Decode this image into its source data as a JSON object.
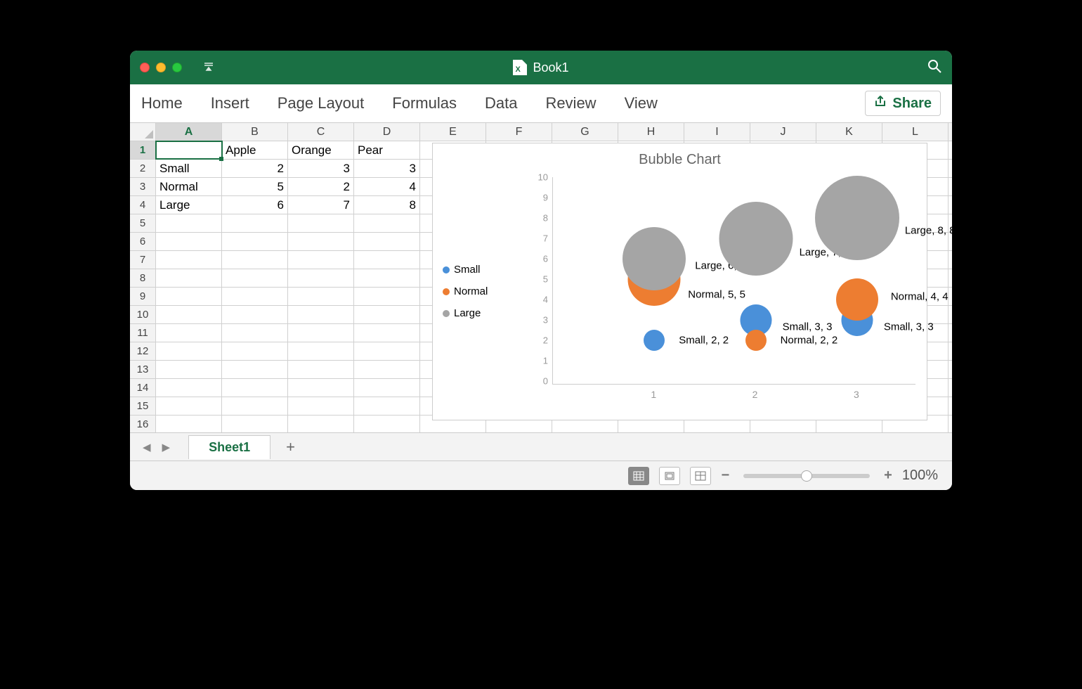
{
  "window": {
    "title": "Book1"
  },
  "ribbon": {
    "tabs": [
      "Home",
      "Insert",
      "Page Layout",
      "Formulas",
      "Data",
      "Review",
      "View"
    ],
    "share_label": "Share"
  },
  "sheet": {
    "columns": [
      "A",
      "B",
      "C",
      "D",
      "E",
      "F",
      "G",
      "H",
      "I",
      "J",
      "K",
      "L"
    ],
    "row_count": 16,
    "active_cell": "A1",
    "cells": {
      "B1": "Apple",
      "C1": "Orange",
      "D1": "Pear",
      "A2": "Small",
      "B2": "2",
      "C2": "3",
      "D2": "3",
      "A3": "Normal",
      "B3": "5",
      "C3": "2",
      "D3": "4",
      "A4": "Large",
      "B4": "6",
      "C4": "7",
      "D4": "8"
    }
  },
  "sheet_tab": {
    "name": "Sheet1"
  },
  "status": {
    "zoom_label": "100%"
  },
  "chart_data": {
    "type": "bubble",
    "title": "Bubble Chart",
    "xlabel": "",
    "ylabel": "",
    "xlim": [
      0,
      3.5
    ],
    "ylim": [
      0,
      10
    ],
    "xticks": [
      1,
      2,
      3
    ],
    "yticks": [
      0,
      1,
      2,
      3,
      4,
      5,
      6,
      7,
      8,
      9,
      10
    ],
    "x_categories_meaning": [
      "Apple",
      "Orange",
      "Pear"
    ],
    "series": [
      {
        "name": "Small",
        "color": "#4a90d9",
        "points": [
          {
            "x": 1,
            "y": 2,
            "size": 2,
            "label": "Small, 2, 2"
          },
          {
            "x": 2,
            "y": 3,
            "size": 3,
            "label": "Small, 3, 3"
          },
          {
            "x": 3,
            "y": 3,
            "size": 3,
            "label": "Small, 3, 3"
          }
        ]
      },
      {
        "name": "Normal",
        "color": "#ed7d31",
        "points": [
          {
            "x": 1,
            "y": 5,
            "size": 5,
            "label": "Normal, 5, 5"
          },
          {
            "x": 2,
            "y": 2,
            "size": 2,
            "label": "Normal, 2, 2"
          },
          {
            "x": 3,
            "y": 4,
            "size": 4,
            "label": "Normal, 4, 4"
          }
        ]
      },
      {
        "name": "Large",
        "color": "#a5a5a5",
        "points": [
          {
            "x": 1,
            "y": 6,
            "size": 6,
            "label": "Large, 6, 6"
          },
          {
            "x": 2,
            "y": 7,
            "size": 7,
            "label": "Large, 7, 7"
          },
          {
            "x": 3,
            "y": 8,
            "size": 8,
            "label": "Large, 8, 8"
          }
        ]
      }
    ],
    "data_label_offsets": {
      "Small, 2, 2": {
        "dx": 35,
        "dy": 0
      },
      "Small, 3, 3_1": {
        "dx": 38,
        "dy": 10
      },
      "Small, 3, 3_2": {
        "dx": 38,
        "dy": 10
      },
      "Normal, 5, 5": {
        "dx": 48,
        "dy": 22
      },
      "Normal, 2, 2": {
        "dx": 35,
        "dy": 0
      },
      "Normal, 4, 4": {
        "dx": 48,
        "dy": -4
      },
      "Large, 6, 6": {
        "dx": 58,
        "dy": 10
      },
      "Large, 7, 7": {
        "dx": 62,
        "dy": 20
      },
      "Large, 8, 8": {
        "dx": 68,
        "dy": 18
      }
    }
  },
  "colors": {
    "titlebar": "#1a7044",
    "accent": "#1a7044",
    "series_small": "#4a90d9",
    "series_normal": "#ed7d31",
    "series_large": "#a5a5a5"
  }
}
